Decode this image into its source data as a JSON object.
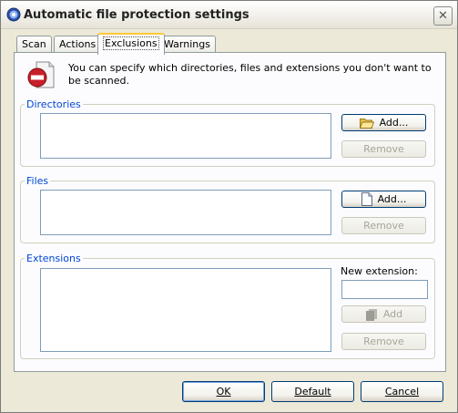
{
  "window": {
    "title": "Automatic file protection settings",
    "close_glyph": "✕"
  },
  "tabs": [
    {
      "label": "Scan"
    },
    {
      "label": "Actions"
    },
    {
      "label": "Exclusions",
      "active": true
    },
    {
      "label": "Warnings"
    }
  ],
  "info": {
    "icon": "no-entry-document-icon",
    "text": "You can specify which directories, files and extensions you don't want to be scanned."
  },
  "directories": {
    "legend": "Directories",
    "items": [],
    "add_label": "Add...",
    "remove_label": "Remove"
  },
  "files": {
    "legend": "Files",
    "items": [],
    "add_label": "Add...",
    "remove_label": "Remove"
  },
  "extensions": {
    "legend": "Extensions",
    "items": [],
    "new_extension_label": "New extension:",
    "new_extension_value": "",
    "add_label": "Add",
    "remove_label": "Remove"
  },
  "footer": {
    "ok_label": "OK",
    "default_label": "Default",
    "cancel_label": "Cancel"
  },
  "colors": {
    "legend": "#0046d5",
    "tab_active_accent": "#ffc83c",
    "button_border": "#003c74"
  }
}
